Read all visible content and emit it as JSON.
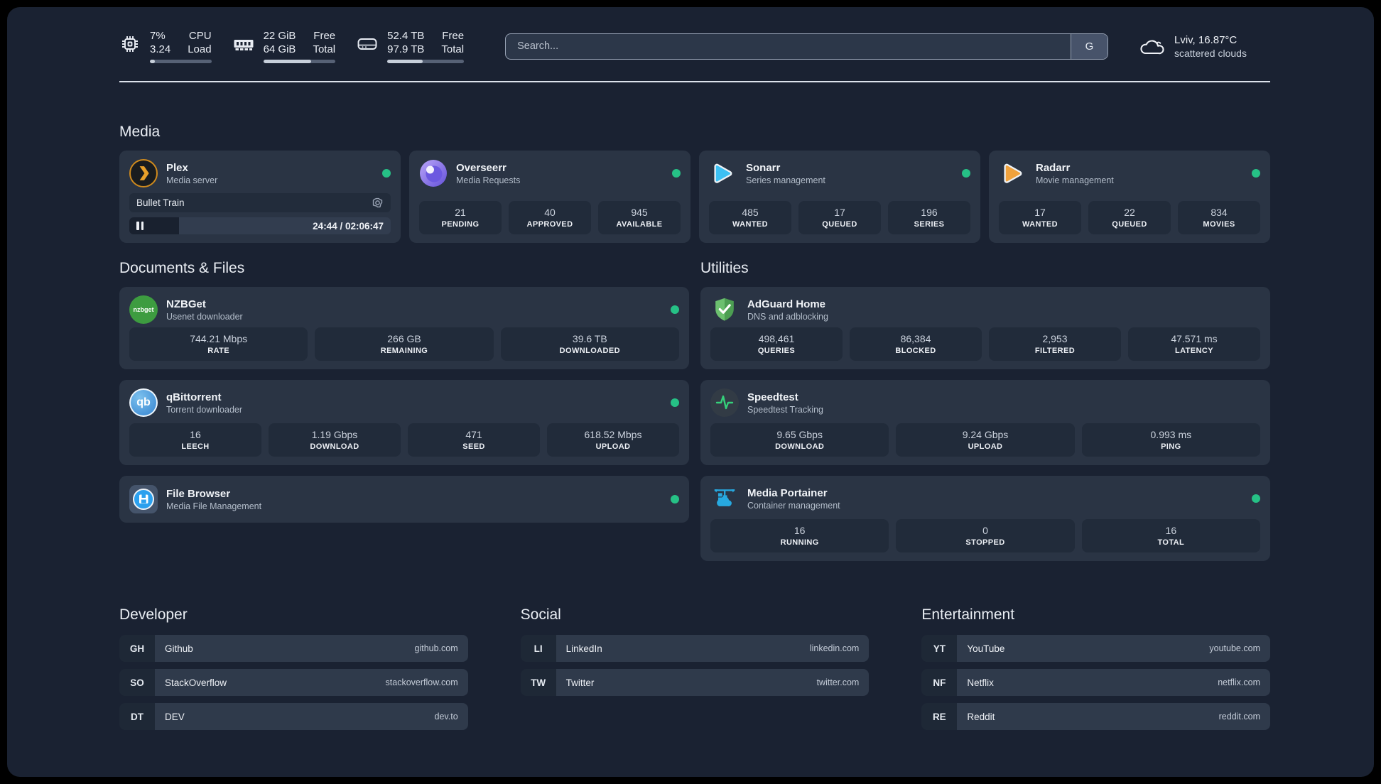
{
  "header": {
    "system": [
      {
        "value_top": "7%",
        "value_bottom": "3.24",
        "label_top": "CPU",
        "label_bottom": "Load",
        "progress": 8
      },
      {
        "value_top": "22 GiB",
        "value_bottom": "64 GiB",
        "label_top": "Free",
        "label_bottom": "Total",
        "progress": 66
      },
      {
        "value_top": "52.4 TB",
        "value_bottom": "97.9 TB",
        "label_top": "Free",
        "label_bottom": "Total",
        "progress": 46
      }
    ],
    "search": {
      "placeholder": "Search...",
      "provider": "G"
    },
    "weather": {
      "location": "Lviv, 16.87°C",
      "condition": "scattered clouds"
    }
  },
  "media": {
    "title": "Media",
    "plex": {
      "name": "Plex",
      "subtitle": "Media server",
      "now_playing": "Bullet Train",
      "time": "24:44 / 02:06:47",
      "progress": 19
    },
    "overseerr": {
      "name": "Overseerr",
      "subtitle": "Media Requests",
      "stats": [
        {
          "value": "21",
          "label": "PENDING"
        },
        {
          "value": "40",
          "label": "APPROVED"
        },
        {
          "value": "945",
          "label": "AVAILABLE"
        }
      ]
    },
    "sonarr": {
      "name": "Sonarr",
      "subtitle": "Series management",
      "stats": [
        {
          "value": "485",
          "label": "WANTED"
        },
        {
          "value": "17",
          "label": "QUEUED"
        },
        {
          "value": "196",
          "label": "SERIES"
        }
      ]
    },
    "radarr": {
      "name": "Radarr",
      "subtitle": "Movie management",
      "stats": [
        {
          "value": "17",
          "label": "WANTED"
        },
        {
          "value": "22",
          "label": "QUEUED"
        },
        {
          "value": "834",
          "label": "MOVIES"
        }
      ]
    }
  },
  "documents": {
    "title": "Documents & Files",
    "nzbget": {
      "name": "NZBGet",
      "subtitle": "Usenet downloader",
      "icon_text": "nzbget",
      "stats": [
        {
          "value": "744.21 Mbps",
          "label": "RATE"
        },
        {
          "value": "266 GB",
          "label": "REMAINING"
        },
        {
          "value": "39.6 TB",
          "label": "DOWNLOADED"
        }
      ]
    },
    "qbittorrent": {
      "name": "qBittorrent",
      "subtitle": "Torrent downloader",
      "icon_text": "qb",
      "stats": [
        {
          "value": "16",
          "label": "LEECH"
        },
        {
          "value": "1.19 Gbps",
          "label": "DOWNLOAD"
        },
        {
          "value": "471",
          "label": "SEED"
        },
        {
          "value": "618.52 Mbps",
          "label": "UPLOAD"
        }
      ]
    },
    "filebrowser": {
      "name": "File Browser",
      "subtitle": "Media File Management"
    }
  },
  "utilities": {
    "title": "Utilities",
    "adguard": {
      "name": "AdGuard Home",
      "subtitle": "DNS and adblocking",
      "stats": [
        {
          "value": "498,461",
          "label": "QUERIES"
        },
        {
          "value": "86,384",
          "label": "BLOCKED"
        },
        {
          "value": "2,953",
          "label": "FILTERED"
        },
        {
          "value": "47.571 ms",
          "label": "LATENCY"
        }
      ]
    },
    "speedtest": {
      "name": "Speedtest",
      "subtitle": "Speedtest Tracking",
      "stats": [
        {
          "value": "9.65 Gbps",
          "label": "DOWNLOAD"
        },
        {
          "value": "9.24 Gbps",
          "label": "UPLOAD"
        },
        {
          "value": "0.993 ms",
          "label": "PING"
        }
      ]
    },
    "portainer": {
      "name": "Media Portainer",
      "subtitle": "Container management",
      "stats": [
        {
          "value": "16",
          "label": "RUNNING"
        },
        {
          "value": "0",
          "label": "STOPPED"
        },
        {
          "value": "16",
          "label": "TOTAL"
        }
      ]
    }
  },
  "bookmarks": {
    "developer": {
      "title": "Developer",
      "links": [
        {
          "tag": "GH",
          "name": "Github",
          "url": "github.com"
        },
        {
          "tag": "SO",
          "name": "StackOverflow",
          "url": "stackoverflow.com"
        },
        {
          "tag": "DT",
          "name": "DEV",
          "url": "dev.to"
        }
      ]
    },
    "social": {
      "title": "Social",
      "links": [
        {
          "tag": "LI",
          "name": "LinkedIn",
          "url": "linkedin.com"
        },
        {
          "tag": "TW",
          "name": "Twitter",
          "url": "twitter.com"
        }
      ]
    },
    "entertainment": {
      "title": "Entertainment",
      "links": [
        {
          "tag": "YT",
          "name": "YouTube",
          "url": "youtube.com"
        },
        {
          "tag": "NF",
          "name": "Netflix",
          "url": "netflix.com"
        },
        {
          "tag": "RE",
          "name": "Reddit",
          "url": "reddit.com"
        }
      ]
    }
  },
  "colors": {
    "background": "#1a2232",
    "card": "#2a3444",
    "status_online": "#26c186"
  }
}
